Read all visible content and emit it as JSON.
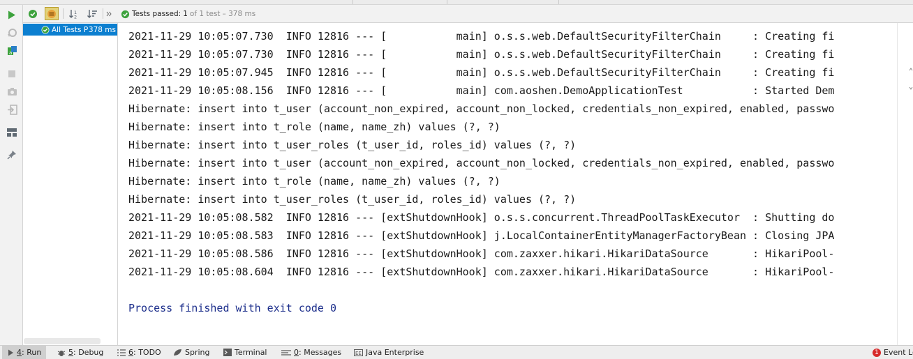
{
  "test_toolbar": {
    "status_label": "Tests passed:",
    "passed_count": "1",
    "of_total": "of 1 test",
    "duration": "– 378 ms",
    "colors": {
      "pass": "#3da23d",
      "active_bg": "#e3d27a"
    }
  },
  "left_toolbar": {
    "icons": [
      "run-icon",
      "rerun-failed-icon",
      "toggle-auto-test-icon",
      "stop-icon",
      "camera-icon",
      "export-icon",
      "layout-icon",
      "pin-icon"
    ]
  },
  "test_tree": {
    "root_label": "All Tests P",
    "root_duration": "378 ms"
  },
  "console": {
    "lines": [
      "2021-11-29 10:05:07.730  INFO 12816 --- [           main] o.s.s.web.DefaultSecurityFilterChain     : Creating fi",
      "2021-11-29 10:05:07.730  INFO 12816 --- [           main] o.s.s.web.DefaultSecurityFilterChain     : Creating fi",
      "2021-11-29 10:05:07.945  INFO 12816 --- [           main] o.s.s.web.DefaultSecurityFilterChain     : Creating fi",
      "2021-11-29 10:05:08.156  INFO 12816 --- [           main] com.aoshen.DemoApplicationTest           : Started Dem",
      "Hibernate: insert into t_user (account_non_expired, account_non_locked, credentials_non_expired, enabled, passwo",
      "Hibernate: insert into t_role (name, name_zh) values (?, ?)",
      "Hibernate: insert into t_user_roles (t_user_id, roles_id) values (?, ?)",
      "Hibernate: insert into t_user (account_non_expired, account_non_locked, credentials_non_expired, enabled, passwo",
      "Hibernate: insert into t_role (name, name_zh) values (?, ?)",
      "Hibernate: insert into t_user_roles (t_user_id, roles_id) values (?, ?)",
      "2021-11-29 10:05:08.582  INFO 12816 --- [extShutdownHook] o.s.s.concurrent.ThreadPoolTaskExecutor  : Shutting do",
      "2021-11-29 10:05:08.583  INFO 12816 --- [extShutdownHook] j.LocalContainerEntityManagerFactoryBean : Closing JPA",
      "2021-11-29 10:05:08.586  INFO 12816 --- [extShutdownHook] com.zaxxer.hikari.HikariDataSource       : HikariPool-",
      "2021-11-29 10:05:08.604  INFO 12816 --- [extShutdownHook] com.zaxxer.hikari.HikariDataSource       : HikariPool-"
    ],
    "exit_message": "Process finished with exit code 0",
    "exit_color": "#1c2e8b"
  },
  "bottom_bar": {
    "run": {
      "num": "4",
      "label": ": Run"
    },
    "debug": {
      "num": "5",
      "label": ": Debug"
    },
    "todo": {
      "num": "6",
      "label": ": TODO"
    },
    "spring": {
      "label": "Spring"
    },
    "terminal": {
      "label": "Terminal"
    },
    "messages": {
      "num": "0",
      "label": ": Messages"
    },
    "java_ee": {
      "label": "Java Enterprise"
    },
    "event_log": {
      "badge": "1",
      "label": "Event Lo"
    }
  }
}
